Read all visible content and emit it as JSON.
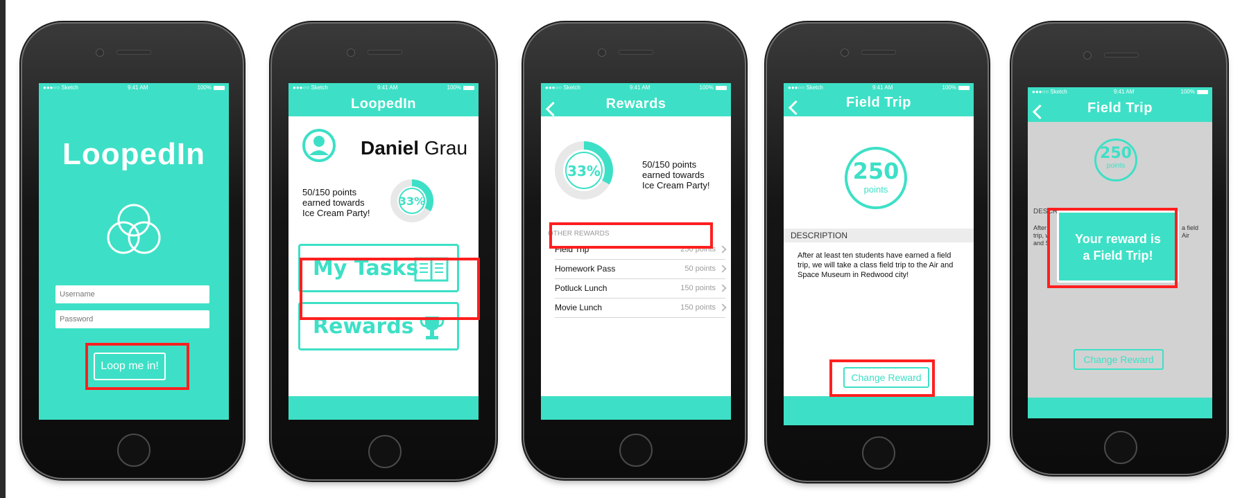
{
  "status_bar": {
    "carrier": "●●●○○ Sketch",
    "wifi": "wifi",
    "time": "9:41 AM",
    "battery": "100%"
  },
  "colors": {
    "accent": "#3de0c6",
    "highlight": "#ff1f1f",
    "white": "#ffffff"
  },
  "screen1": {
    "title": "LoopedIn",
    "logo": "three-circles-logo-icon",
    "username_placeholder": "Username",
    "password_placeholder": "Password",
    "login_button": "Loop me in!"
  },
  "screen2": {
    "nav_title": "LoopedIn",
    "first_name": "Daniel",
    "last_name": "Grau",
    "points_line1": "50/150 points",
    "points_line2": "earned towards",
    "points_line3": "Ice Cream Party!",
    "progress_label": "33%",
    "progress_value": 0.33,
    "tasks_button": "My Tasks",
    "rewards_button": "Rewards"
  },
  "screen3": {
    "nav_title": "Rewards",
    "progress_label": "33%",
    "progress_value": 0.33,
    "points_line1": "50/150 points",
    "points_line2": "earned towards",
    "points_line3": "Ice Cream Party!",
    "section_label": "OTHER REWARDS",
    "rewards": [
      {
        "name": "Field Trip",
        "points": "250 points"
      },
      {
        "name": "Homework Pass",
        "points": "50 points"
      },
      {
        "name": "Potluck Lunch",
        "points": "150 points"
      },
      {
        "name": "Movie Lunch",
        "points": "150 points"
      }
    ]
  },
  "screen4": {
    "nav_title": "Field Trip",
    "points_value": "250",
    "points_unit": "points",
    "description_header": "DESCRIPTION",
    "description": "After at least ten students have earned a field trip, we will take a class field trip to the Air and Space Museum in Redwood city!",
    "change_button": "Change Reward"
  },
  "screen5": {
    "nav_title": "Field Trip",
    "points_value": "250",
    "points_unit": "points",
    "description_header": "DESCRIPTION",
    "bg_text_left1": "After",
    "bg_text_left2": "trip, w",
    "bg_text_left3": "and S",
    "bg_text_right1": "a field",
    "bg_text_right2": "Air",
    "popup_line1": "Your reward is",
    "popup_line2": "a Field Trip!",
    "change_button": "Change Reward"
  }
}
